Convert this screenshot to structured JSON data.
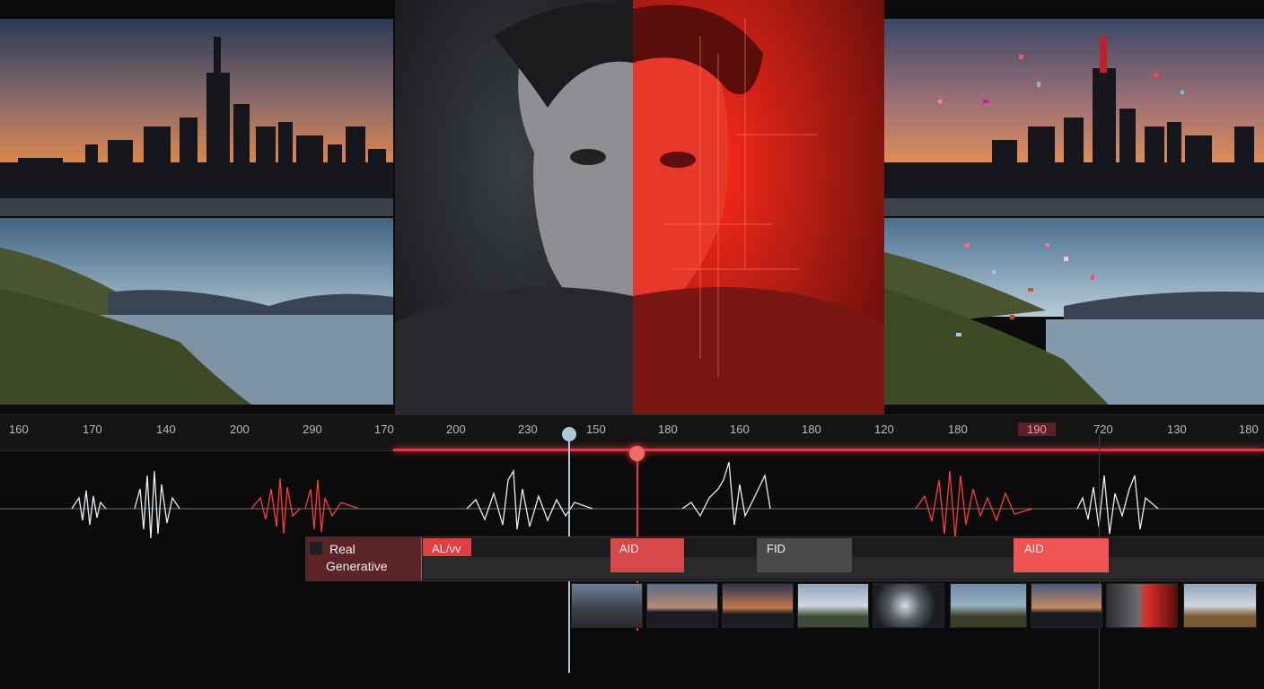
{
  "ruler": {
    "ticks": [
      "160",
      "170",
      "140",
      "200",
      "290",
      "170",
      "200",
      "230",
      "150",
      "180",
      "160",
      "180",
      "120",
      "180",
      "190",
      "720",
      "130",
      "180"
    ],
    "highlighted_tick": "190"
  },
  "labels": {
    "real": "Real",
    "generative": "Generative"
  },
  "clips": [
    {
      "label": "AL/νv",
      "color": "#e04040"
    },
    {
      "label": "AID",
      "color": "#d94848"
    },
    {
      "label": "FID",
      "color": "#4a4a4c"
    },
    {
      "label": "AID",
      "color": "#ef5454"
    }
  ],
  "colors": {
    "accent_red": "#e03a3a",
    "playhead_light": "#a9c8d8",
    "background": "#0b0b0c"
  },
  "icons": {
    "label_swatch": "square-swatch-icon"
  }
}
